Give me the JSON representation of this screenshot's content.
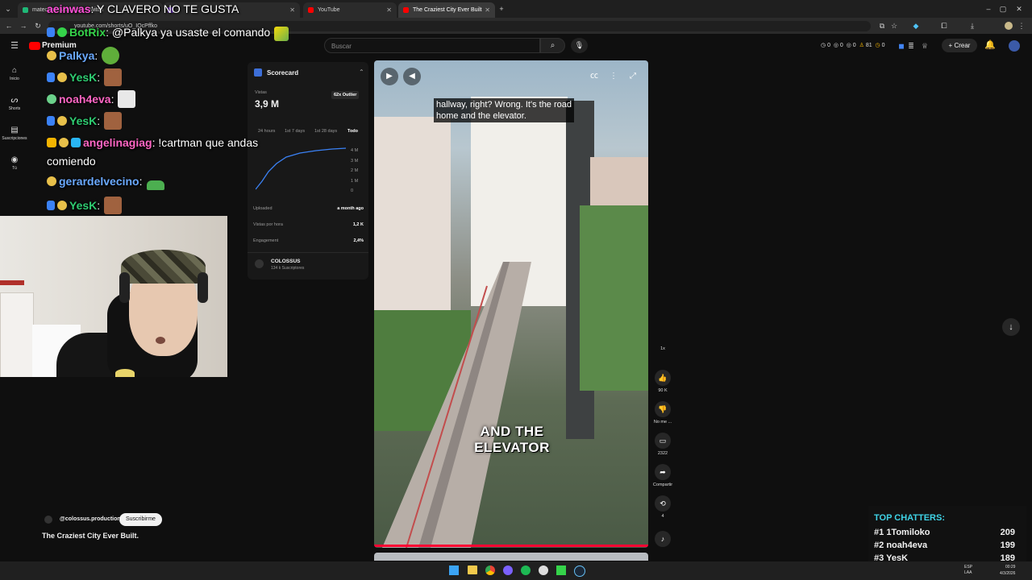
{
  "browser": {
    "tabs": [
      {
        "label": "matecapo (Vatcalm) - Twitch",
        "color": "#1fb877"
      },
      {
        "label": "",
        "color": "#9146ff"
      },
      {
        "label": "YouTube",
        "color": "#ff0000"
      },
      {
        "label": "The Craziest City Ever Built",
        "color": "#ff0000"
      }
    ],
    "url": "youtube.com/shorts/uO_IQcPffko",
    "new_tab": "+"
  },
  "youtube": {
    "logo_text": "Premium",
    "search_placeholder": "Buscar",
    "create_label": "Crear",
    "stats": [
      "0",
      "0",
      "0",
      "81",
      "0"
    ],
    "rail": [
      {
        "icon": "⌂",
        "label": "Inicio"
      },
      {
        "icon": "ᔕ",
        "label": "Shorts"
      },
      {
        "icon": "▤",
        "label": "Suscripciones"
      },
      {
        "icon": "◉",
        "label": "Tú"
      }
    ]
  },
  "chat": [
    {
      "user": "aeinwas",
      "text": ": Y CLAVERO NO TE GUSTA",
      "color": "#ff4fd8"
    },
    {
      "user": "BotRix",
      "text": ": @Palkya ya usaste el comando",
      "color": "#35d34a"
    },
    {
      "user": "Palkya",
      "text": ":",
      "color": "#6aa9ff"
    },
    {
      "user": "YesK",
      "text": ":",
      "color": "#2ecc71"
    },
    {
      "user": "noah4eva",
      "text": ":",
      "color": "#ff66c4"
    },
    {
      "user": "YesK",
      "text": ":",
      "color": "#2ecc71"
    },
    {
      "user": "angelinagiag",
      "text": ": !cartman que andas",
      "color": "#ff66c4"
    },
    {
      "user": "",
      "text": "comiendo",
      "color": "#ffffff"
    },
    {
      "user": "gerardelvecino",
      "text": ":",
      "color": "#6aa9ff"
    },
    {
      "user": "YesK",
      "text": ":",
      "color": "#2ecc71"
    }
  ],
  "scorecard": {
    "title": "Scorecard",
    "views_label": "Vistas",
    "views_value": "3,9 M",
    "outlier": "62x Outlier",
    "ranges": [
      "24 hours",
      "1st 7 days",
      "1st 28 days",
      "Todo"
    ],
    "yticks": [
      "4 M",
      "3 M",
      "2 M",
      "1 M",
      "0"
    ],
    "uploaded_label": "Uploaded",
    "uploaded_value": "a month ago",
    "vph_label": "Vistas por hora",
    "vph_value": "1,2 K",
    "engagement_label": "Engagement",
    "engagement_value": "2,4%",
    "channel": "COLOSSUS",
    "subs": "134 k Suscriptores"
  },
  "video": {
    "caption_line1": "hallway, right? Wrong. It's the road",
    "caption_line2": "home and the elevator.",
    "overlay_line1": "AND THE",
    "overlay_line2": "ELEVATOR",
    "channel_handle": "@colossus.production",
    "subscribe_label": "Suscribirme",
    "title": "The Craziest City Ever Built."
  },
  "actions": {
    "speed": "1x",
    "likes": "90 K",
    "dislike_label": "No me ...",
    "comments": "2322",
    "share_label": "Compartir",
    "remix": "4"
  },
  "top_chatters": {
    "title": "TOP CHATTERS:",
    "rows": [
      {
        "rank": "#1",
        "name": "1Tomiloko",
        "count": "209"
      },
      {
        "rank": "#2",
        "name": "noah4eva",
        "count": "199"
      },
      {
        "rank": "#3",
        "name": "YesK",
        "count": "189"
      }
    ]
  },
  "taskbar": {
    "lang": "ESP\nLAA",
    "time": "00:29",
    "date": "4/3/2026"
  }
}
